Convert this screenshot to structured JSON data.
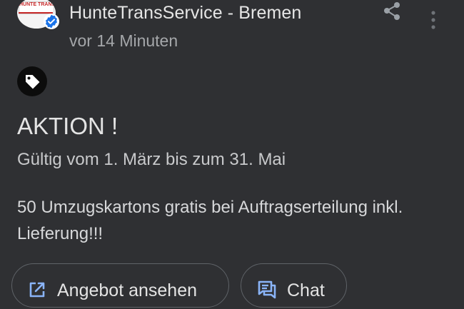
{
  "merchant": {
    "logo_text": "HUNTE TRANS",
    "name": "HunteTransService - Bremen",
    "posted": "vor 14 Minuten",
    "verified": true
  },
  "post": {
    "type_icon": "tag-icon",
    "title": "AKTION !",
    "validity": "Gültig vom 1. März bis zum 31. Mai",
    "description": "50 Umzugskartons gratis bei Auftragserteilung inkl. Lieferung!!!"
  },
  "actions": {
    "view_offer": "Angebot ansehen",
    "chat": "Chat"
  },
  "icons": {
    "share": "share-icon",
    "more": "more-vert-icon",
    "verified": "verified-check-icon",
    "open_external": "open-external-icon",
    "chat": "chat-bubble-icon"
  },
  "colors": {
    "background": "#2f3033",
    "accent_blue": "#8ab4f8",
    "verified_blue": "#1a73e8",
    "text_primary": "#e4e4e4",
    "text_secondary": "#a5a7aa",
    "chip_border": "#5f6368"
  }
}
